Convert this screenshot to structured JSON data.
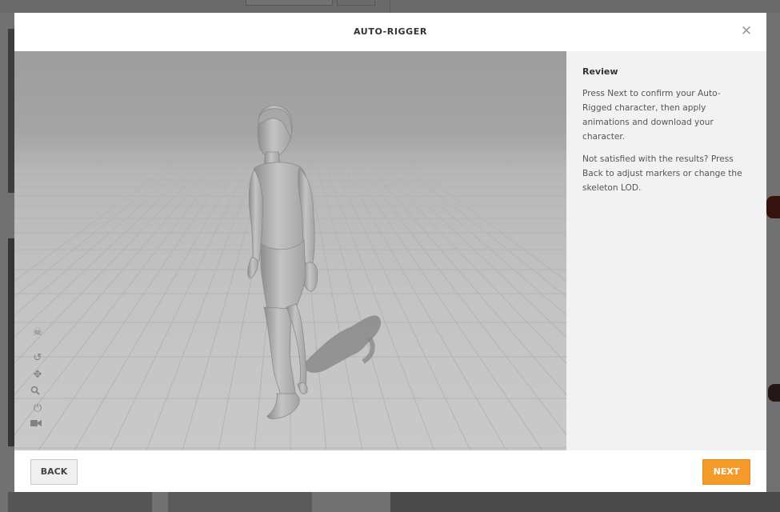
{
  "dialog": {
    "title": "AUTO-RIGGER",
    "close_icon": "close-icon"
  },
  "panel": {
    "heading": "Review",
    "paragraph_1": "Press Next to confirm your Auto-Rigged character, then apply animations and download your character.",
    "paragraph_2": "Not satisfied with the results? Press Back to adjust markers or change the skeleton LOD."
  },
  "viewport_tools": [
    {
      "name": "skeleton-icon",
      "glyph": "☠"
    },
    {
      "name": "rotate-icon",
      "glyph": "↺"
    },
    {
      "name": "pan-icon",
      "glyph": "✥"
    },
    {
      "name": "zoom-icon",
      "glyph": "🔍"
    },
    {
      "name": "power-icon",
      "glyph": "⏻"
    },
    {
      "name": "camera-icon",
      "glyph": "■"
    }
  ],
  "footer": {
    "back_label": "BACK",
    "next_label": "NEXT"
  },
  "colors": {
    "accent": "#f49b2a",
    "panel_bg": "#f2f2f2",
    "viewport_floor": "#c6c6c6"
  }
}
